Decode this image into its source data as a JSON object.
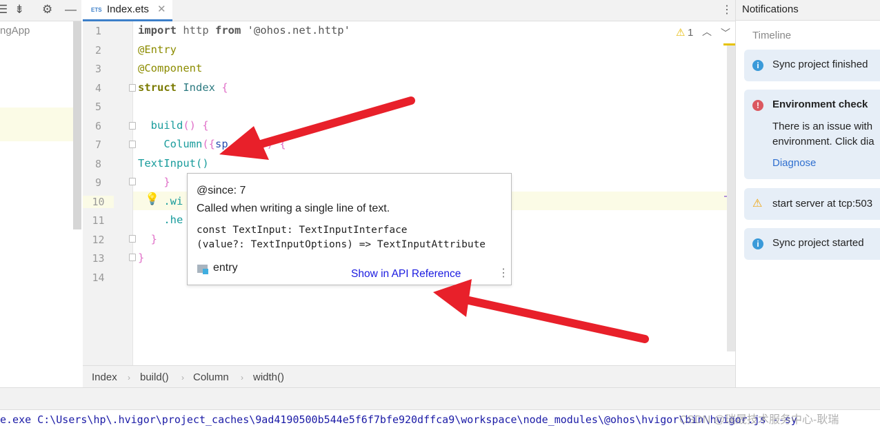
{
  "left_panel": {
    "project_fragment": "ngApp",
    "icons": [
      "expand-icon",
      "collapse-icon",
      "gear-icon",
      "minimize-icon"
    ]
  },
  "editor": {
    "tab": {
      "label": "Index.ets",
      "icon_text": "ETS"
    },
    "inspection": {
      "warning_count": "1"
    },
    "lines": [
      {
        "n": "1"
      },
      {
        "n": "2"
      },
      {
        "n": "3"
      },
      {
        "n": "4"
      },
      {
        "n": "5"
      },
      {
        "n": "6"
      },
      {
        "n": "7"
      },
      {
        "n": "8"
      },
      {
        "n": "9"
      },
      {
        "n": "10"
      },
      {
        "n": "11"
      },
      {
        "n": "12"
      },
      {
        "n": "13"
      },
      {
        "n": "14"
      }
    ],
    "code": {
      "l1a": "import",
      "l1b": " http ",
      "l1c": "from",
      "l1d": " '@ohos.net.http'",
      "l2": "@Entry",
      "l3": "@Component",
      "l4a": "struct",
      "l4b": " Index ",
      "l4c": "{",
      "l6a": "  build",
      "l6b": "() {",
      "l7a": "    Column",
      "l7b": "({",
      "l7c": "sp",
      "l7d": "   30",
      "l7e": "}) {",
      "l8": "TextInput()",
      "l9": "    }",
      "l10": "    .wi",
      "l11": "    .he",
      "l12": "  }",
      "l13": "}"
    },
    "popup": {
      "since": "@since: 7",
      "description": "Called when writing a single line of text.",
      "signature_1": "const TextInput: TextInputInterface",
      "signature_2": "(value?: TextInputOptions) => TextInputAttribute",
      "module": "entry",
      "link": "Show in API Reference"
    },
    "breadcrumb": [
      "Index",
      "build()",
      "Column",
      "width()"
    ]
  },
  "notifications": {
    "title": "Notifications",
    "section": "Timeline",
    "items": [
      {
        "type": "info",
        "text": "Sync project finished"
      },
      {
        "type": "error",
        "title": "Environment check",
        "body_1": "There is an issue with",
        "body_2": "environment. Click dia",
        "link": "Diagnose"
      },
      {
        "type": "warning",
        "text": "start server at tcp:503"
      },
      {
        "type": "info",
        "text": "Sync project started"
      }
    ]
  },
  "console": {
    "line": "e.exe C:\\Users\\hp\\.hvigor\\project_caches\\9ad4190500b544e5f6f7bfe920dffca9\\workspace\\node_modules\\@ohos\\hvigor\\bin\\hvigor.js --sy"
  },
  "watermark": "CSDN @瑞晟技术服务中心-耿瑞",
  "colors": {
    "accent": "#3c7fc9",
    "arrow": "#e8202a",
    "info": "#3a9ad9",
    "error": "#db5860",
    "warning": "#f0a30a",
    "link": "#2f6fcf"
  }
}
